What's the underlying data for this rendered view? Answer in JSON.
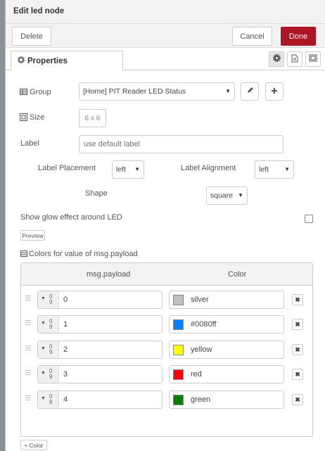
{
  "header": {
    "title": "Edit led node"
  },
  "toolbar": {
    "delete_label": "Delete",
    "cancel_label": "Cancel",
    "done_label": "Done"
  },
  "tabs": {
    "properties_label": "Properties"
  },
  "form": {
    "group_label": "Group",
    "group_value": "[Home] PIT Reader LED Status",
    "size_label": "Size",
    "size_value": "6 x 6",
    "label_label": "Label",
    "label_placeholder": "use default label",
    "label_placement_label": "Label Placement",
    "label_placement_value": "left",
    "label_alignment_label": "Label Alignment",
    "label_alignment_value": "left",
    "shape_label": "Shape",
    "shape_value": "square",
    "glow_label": "Show glow effect around LED",
    "glow_checked": false,
    "preview_label": "Preview",
    "colors_label": "Colors for value of msg.payload"
  },
  "colors_table": {
    "col_payload": "msg.payload",
    "col_color": "Color",
    "rows": [
      {
        "value": "0",
        "color_name": "silver",
        "color": "#c0c0c0"
      },
      {
        "value": "1",
        "color_name": "#0080ff",
        "color": "#0080ff"
      },
      {
        "value": "2",
        "color_name": "yellow",
        "color": "#ffff00"
      },
      {
        "value": "3",
        "color_name": "red",
        "color": "#ff0000"
      },
      {
        "value": "4",
        "color_name": "green",
        "color": "#008000"
      }
    ]
  },
  "add_color_label": "Color",
  "accent_color": "#ad1625"
}
